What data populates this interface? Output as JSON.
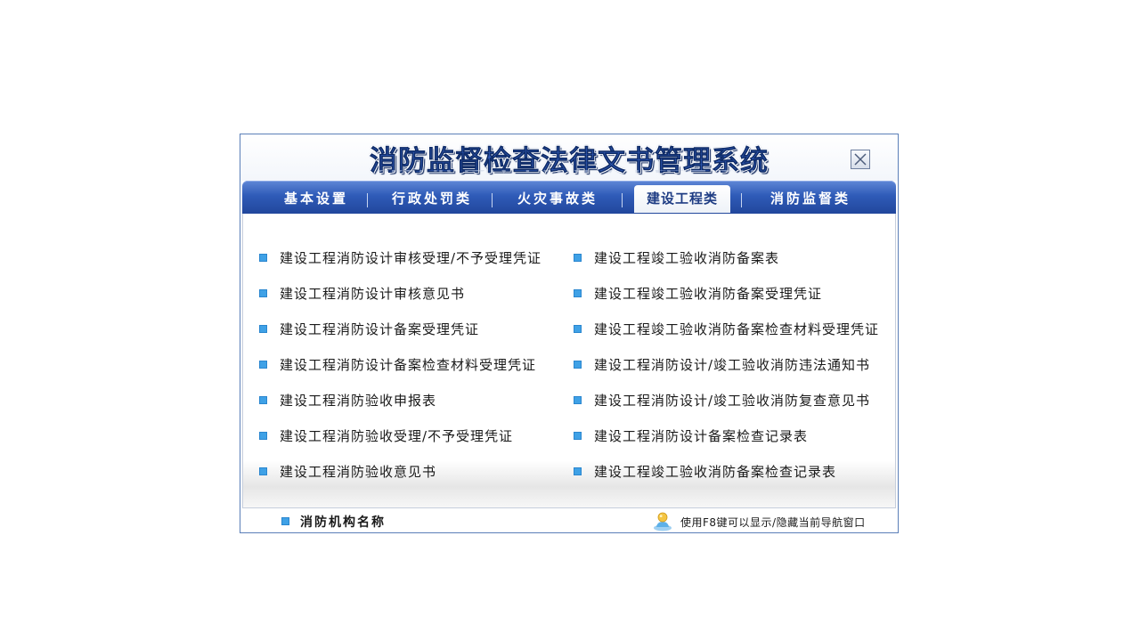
{
  "window": {
    "title": "消防监督检查法律文书管理系统"
  },
  "tabs": [
    {
      "label": "基本设置",
      "active": false
    },
    {
      "label": "行政处罚类",
      "active": false
    },
    {
      "label": "火灾事故类",
      "active": false
    },
    {
      "label": "建设工程类",
      "active": true
    },
    {
      "label": "消防监督类",
      "active": false
    }
  ],
  "documents": {
    "left": [
      "建设工程消防设计审核受理/不予受理凭证",
      "建设工程消防设计审核意见书",
      "建设工程消防设计备案受理凭证",
      "建设工程消防设计备案检查材料受理凭证",
      "建设工程消防验收申报表",
      "建设工程消防验收受理/不予受理凭证",
      "建设工程消防验收意见书"
    ],
    "right": [
      "建设工程竣工验收消防备案表",
      "建设工程竣工验收消防备案受理凭证",
      "建设工程竣工验收消防备案检查材料受理凭证",
      "建设工程消防设计/竣工验收消防违法通知书",
      "建设工程消防设计/竣工验收消防复查意见书",
      "建设工程消防设计备案检查记录表",
      "建设工程竣工验收消防备案检查记录表"
    ]
  },
  "footer": {
    "org_name": "消防机构名称",
    "hint": "使用F8键可以显示/隐藏当前导航窗口"
  },
  "icons": {
    "close": "close-icon",
    "bullet": "square-bullet-icon",
    "hint": "info-person-icon"
  },
  "colors": {
    "tabbar": "#2f5bb8",
    "title": "#2f58b3",
    "bullet": "#3fa1e6",
    "border": "#5b7fb8"
  }
}
